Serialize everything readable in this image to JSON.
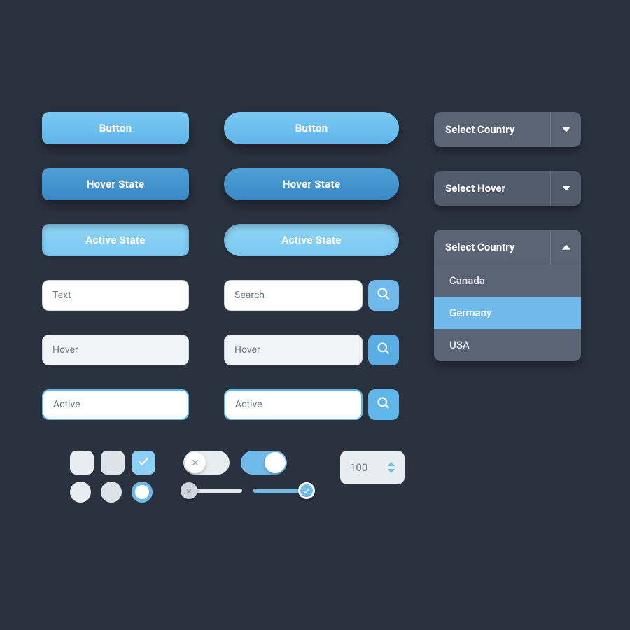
{
  "buttons": {
    "normal": "Button",
    "hover": "Hover State",
    "active": "Active State"
  },
  "inputs": {
    "text_normal": "Text",
    "text_hover": "Hover",
    "text_active": "Active",
    "search_normal": "Search",
    "search_hover": "Hover",
    "search_active": "Active"
  },
  "selects": {
    "normal_label": "Select Country",
    "hover_label": "Select Hover",
    "open_label": "Select Country",
    "options": [
      "Canada",
      "Germany",
      "USA"
    ],
    "selected_index": 1
  },
  "stepper": {
    "value": "100"
  },
  "colors": {
    "accent": "#6fbaea",
    "bg": "#2a3240",
    "panel": "#5a6475"
  }
}
